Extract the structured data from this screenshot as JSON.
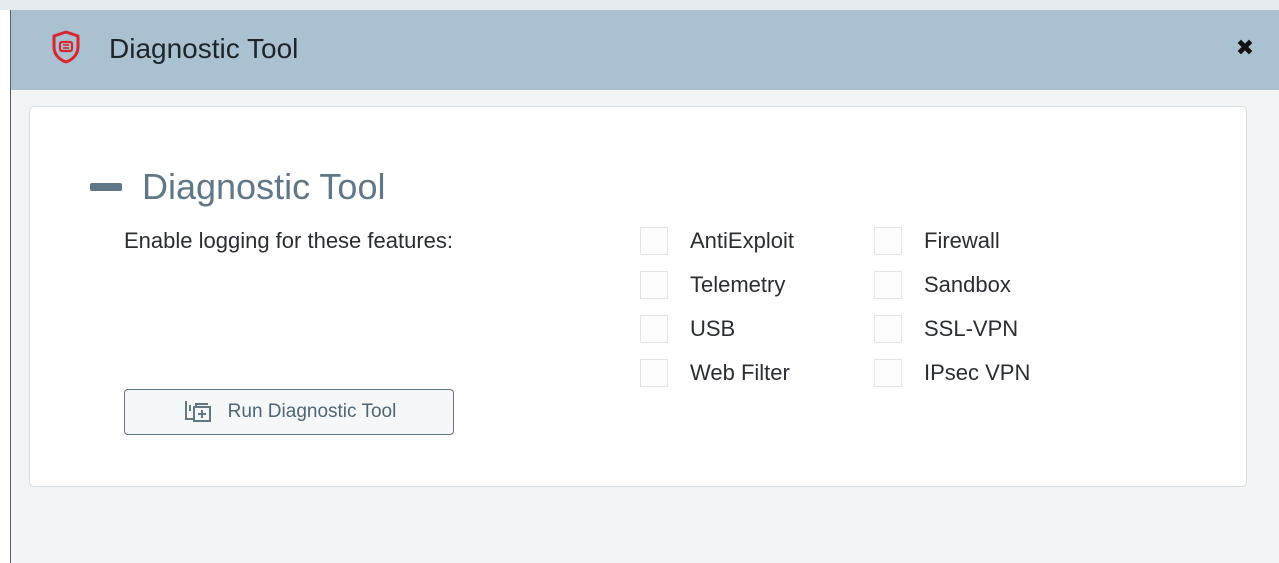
{
  "window": {
    "title": "Diagnostic Tool",
    "icon": "forticlient-shield-icon",
    "close_icon": "close-icon"
  },
  "section": {
    "title": "Diagnostic Tool",
    "collapse_icon": "minus-icon",
    "enable_label": "Enable logging for these features:"
  },
  "features": [
    {
      "label": "AntiExploit",
      "checked": false
    },
    {
      "label": "Firewall",
      "checked": false
    },
    {
      "label": "Telemetry",
      "checked": false
    },
    {
      "label": "Sandbox",
      "checked": false
    },
    {
      "label": "USB",
      "checked": false
    },
    {
      "label": "SSL-VPN",
      "checked": false
    },
    {
      "label": "Web Filter",
      "checked": false
    },
    {
      "label": "IPsec VPN",
      "checked": false
    }
  ],
  "run_button": {
    "label": "Run Diagnostic Tool",
    "icon": "run-diagnostic-icon"
  },
  "colors": {
    "titlebar": "#a9c1d0",
    "accent": "#5f7787",
    "brand_red": "#d8262f"
  }
}
